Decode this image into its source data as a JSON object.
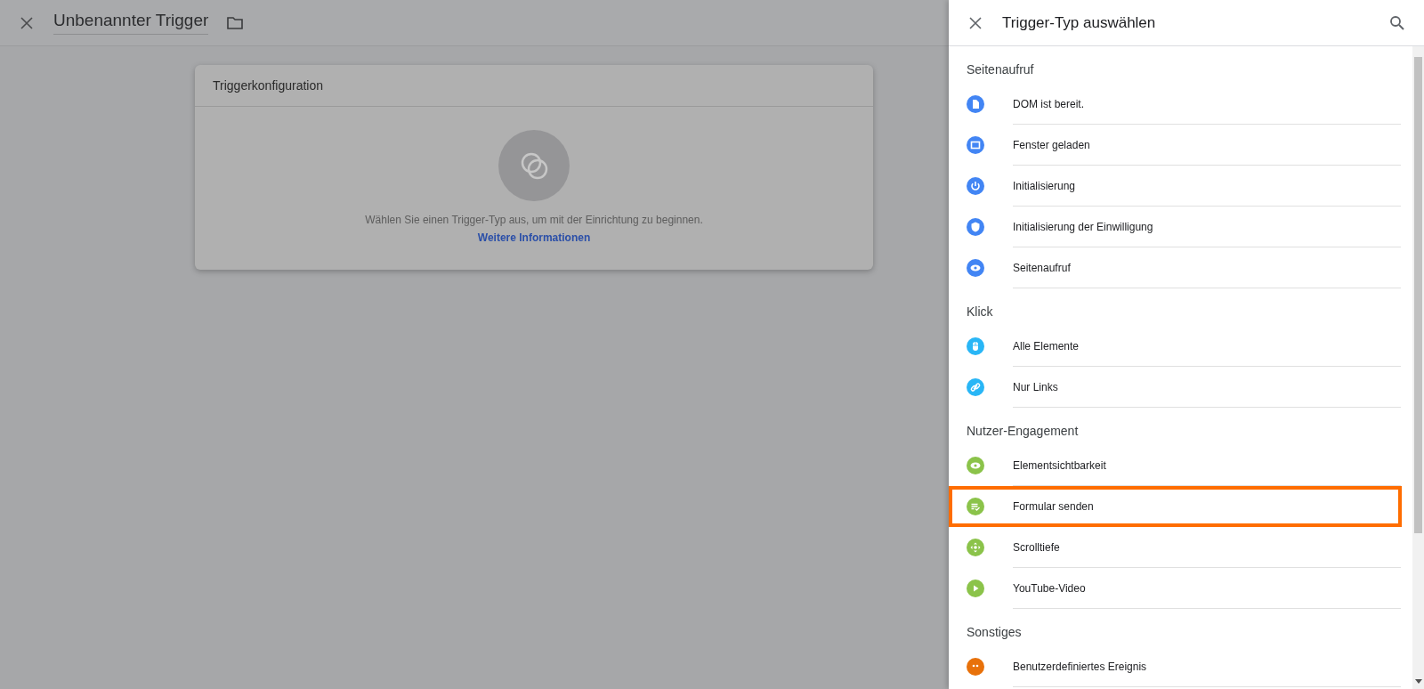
{
  "top_bar": {
    "title": "Unbenannter Trigger"
  },
  "card": {
    "title": "Triggerkonfiguration",
    "message": "Wählen Sie einen Trigger-Typ aus, um mit der Einrichtung zu beginnen.",
    "link": "Weitere Informationen"
  },
  "panel": {
    "title": "Trigger-Typ auswählen",
    "groups": [
      {
        "label": "Seitenaufruf",
        "color": "#4285f4",
        "items": [
          {
            "label": "DOM ist bereit.",
            "selected": false
          },
          {
            "label": "Fenster geladen",
            "selected": false
          },
          {
            "label": "Initialisierung",
            "selected": false
          },
          {
            "label": "Initialisierung der Einwilligung",
            "selected": false
          },
          {
            "label": "Seitenaufruf",
            "selected": false
          }
        ]
      },
      {
        "label": "Klick",
        "color": "#29b6f6",
        "items": [
          {
            "label": "Alle Elemente",
            "selected": false
          },
          {
            "label": "Nur Links",
            "selected": false
          }
        ]
      },
      {
        "label": "Nutzer-Engagement",
        "color": "#8bc34a",
        "items": [
          {
            "label": "Elementsichtbarkeit",
            "selected": false
          },
          {
            "label": "Formular senden",
            "selected": true
          },
          {
            "label": "Scrolltiefe",
            "selected": false
          },
          {
            "label": "YouTube-Video",
            "selected": false
          }
        ]
      },
      {
        "label": "Sonstiges",
        "color": "#e8710a",
        "items": [
          {
            "label": "Benutzerdefiniertes Ereignis",
            "selected": false
          }
        ]
      }
    ]
  }
}
